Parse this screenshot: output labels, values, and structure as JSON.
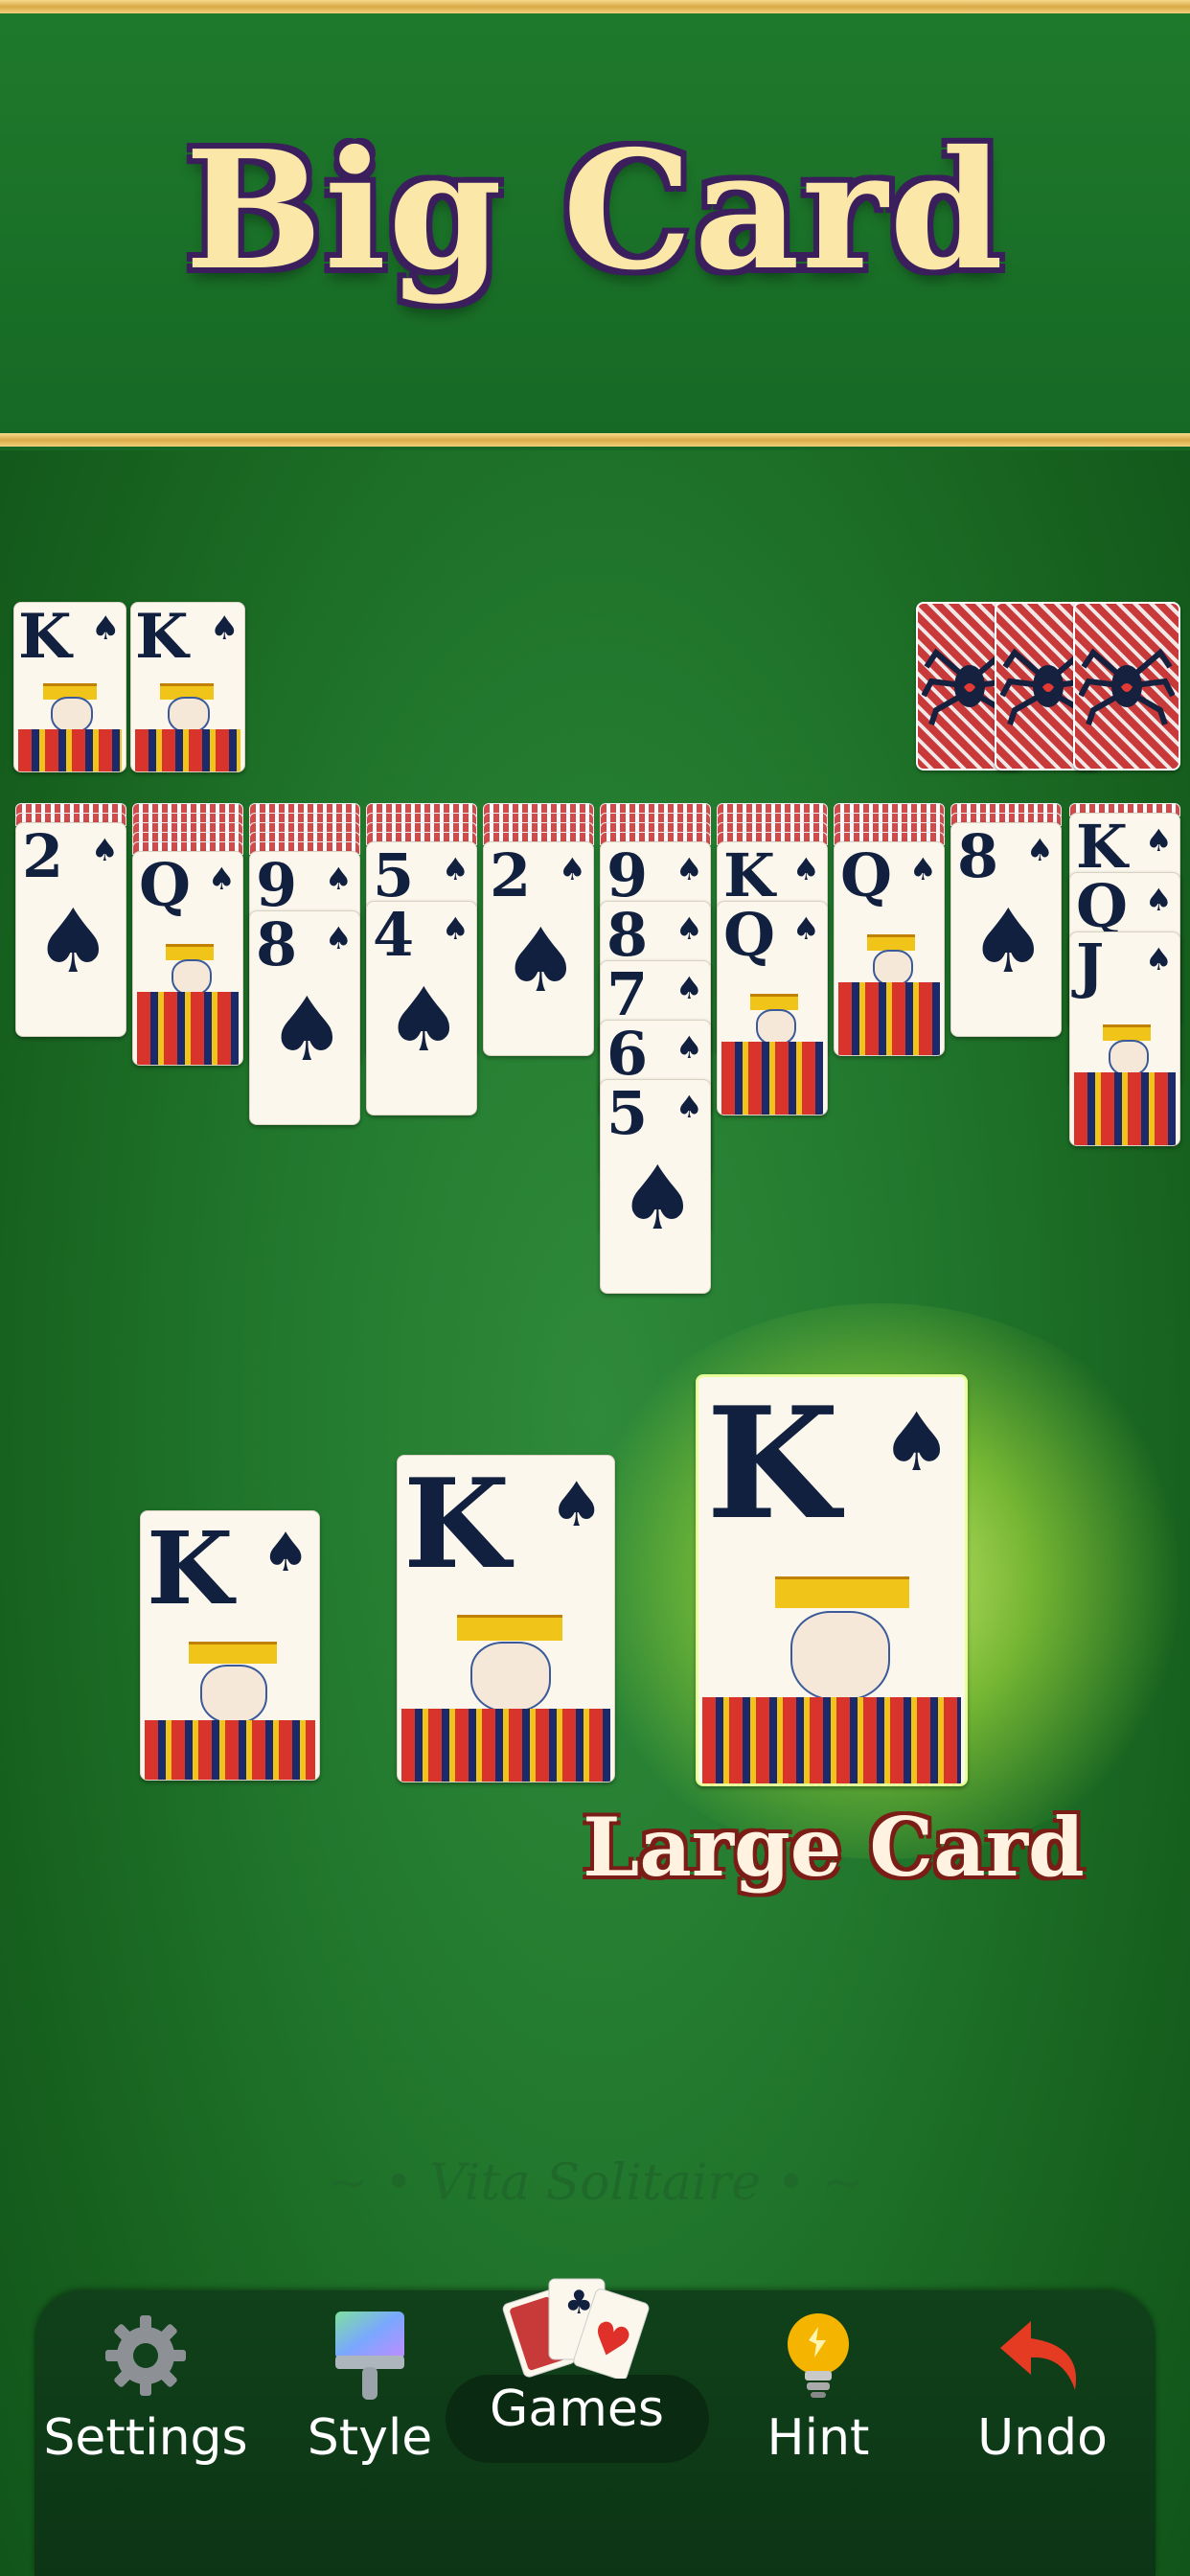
{
  "header": {
    "title": "Big Card"
  },
  "foundations": [
    {
      "rank": "K",
      "suit": "♠"
    },
    {
      "rank": "K",
      "suit": "♠"
    }
  ],
  "stock": {
    "count": 3,
    "icon": "spider-icon"
  },
  "tableau": [
    {
      "backs": 2,
      "cards": [
        {
          "rank": "2",
          "suit": "♠"
        }
      ]
    },
    {
      "backs": 5,
      "cards": [
        {
          "rank": "Q",
          "suit": "♠"
        }
      ]
    },
    {
      "backs": 5,
      "cards": [
        {
          "rank": "9",
          "suit": "♠"
        },
        {
          "rank": "8",
          "suit": "♠"
        }
      ]
    },
    {
      "backs": 4,
      "cards": [
        {
          "rank": "5",
          "suit": "♠"
        },
        {
          "rank": "4",
          "suit": "♠"
        }
      ]
    },
    {
      "backs": 4,
      "cards": [
        {
          "rank": "2",
          "suit": "♠"
        }
      ]
    },
    {
      "backs": 4,
      "cards": [
        {
          "rank": "9",
          "suit": "♠"
        },
        {
          "rank": "8",
          "suit": "♠"
        },
        {
          "rank": "7",
          "suit": "♠"
        },
        {
          "rank": "6",
          "suit": "♠"
        },
        {
          "rank": "5",
          "suit": "♠"
        }
      ]
    },
    {
      "backs": 4,
      "cards": [
        {
          "rank": "K",
          "suit": "♠"
        },
        {
          "rank": "Q",
          "suit": "♠"
        }
      ]
    },
    {
      "backs": 4,
      "cards": [
        {
          "rank": "Q",
          "suit": "♠"
        }
      ]
    },
    {
      "backs": 2,
      "cards": [
        {
          "rank": "8",
          "suit": "♠"
        }
      ]
    },
    {
      "backs": 1,
      "cards": [
        {
          "rank": "K",
          "suit": "♠"
        },
        {
          "rank": "Q",
          "suit": "♠"
        },
        {
          "rank": "J",
          "suit": "♠"
        }
      ]
    }
  ],
  "size_preview": {
    "cards": [
      {
        "rank": "K",
        "suit": "♠"
      },
      {
        "rank": "K",
        "suit": "♠"
      },
      {
        "rank": "K",
        "suit": "♠"
      }
    ],
    "selected_label": "Large Card"
  },
  "watermark": "~ • Vita Solitaire • ~",
  "nav": {
    "settings": "Settings",
    "style": "Style",
    "games": "Games",
    "hint": "Hint",
    "undo": "Undo"
  },
  "colors": {
    "felt": "#237a2f",
    "gold": "#d9a947",
    "card_ink": "#12203f",
    "nav_bg": "#0c3515"
  }
}
